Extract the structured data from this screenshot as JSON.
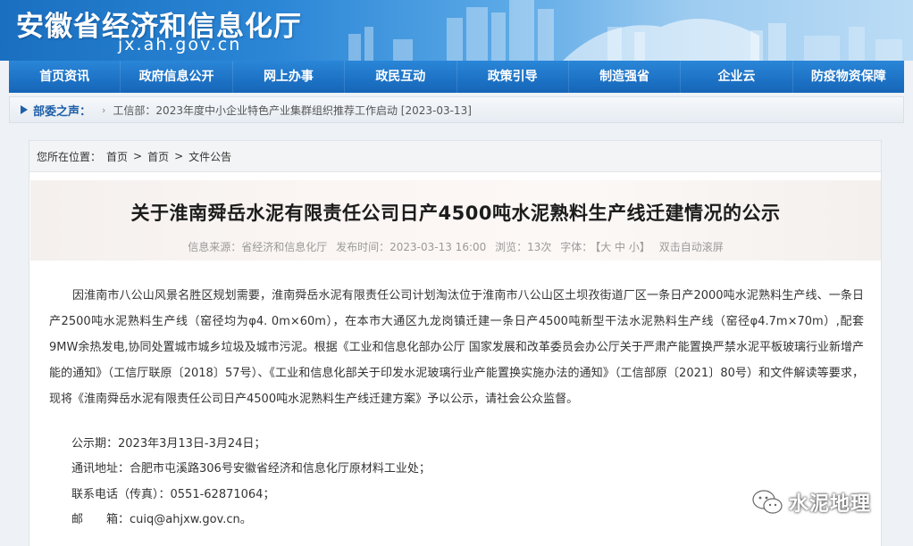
{
  "banner": {
    "title": "安徽省经济和信息化厅",
    "domain": "jx.ah.gov.cn"
  },
  "nav": {
    "items": [
      "首页资讯",
      "政府信息公开",
      "网上办事",
      "政民互动",
      "政策引导",
      "制造强省",
      "企业云",
      "防疫物资保障"
    ]
  },
  "ticker": {
    "label": "部委之声：",
    "bullet": "›",
    "text": "工信部：2023年度中小企业特色产业集群组织推荐工作启动 [2023-03-13]"
  },
  "breadcrumb": {
    "prefix": "您所在位置：",
    "items": [
      "首页",
      "首页",
      "文件公告"
    ],
    "separator": ">"
  },
  "article": {
    "title": "关于淮南舜岳水泥有限责任公司日产4500吨水泥熟料生产线迁建情况的公示",
    "source": "信息来源：省经济和信息化厅",
    "published": "发布时间：2023-03-13 16:00",
    "views": "浏览：13次",
    "font_label": "字体：",
    "font_size_control": "【大 中 小】",
    "autoscroll": "双击自动滚屏",
    "body": "因淮南市八公山风景名胜区规划需要，淮南舜岳水泥有限责任公司计划淘汰位于淮南市八公山区土坝孜街道厂区一条日产2000吨水泥熟料生产线、一条日产2500吨水泥熟料生产线（窑径均为φ4. 0m×60m），在本市大通区九龙岗镇迁建一条日产4500吨新型干法水泥熟料生产线（窑径φ4.7m×70m）,配套9MW余热发电,协同处置城市城乡垃圾及城市污泥。根据《工业和信息化部办公厅 国家发展和改革委员会办公厅关于严肃产能置换严禁水泥平板玻璃行业新增产能的通知》（工信厅联原〔2018〕57号）、《工业和信息化部关于印发水泥玻璃行业产能置换实施办法的通知》（工信部原〔2021〕80号）和文件解读等要求，现将《淮南舜岳水泥有限责任公司日产4500吨水泥熟料生产线迁建方案》予以公示，请社会公众监督。",
    "notice_period": "公示期：2023年3月13日-3月24日；",
    "address": "通讯地址：合肥市屯溪路306号安徽省经济和信息化厅原材料工业处；",
    "phone": "联系电话（传真）：0551-62871064；",
    "email": "邮　　箱：cuiq@ahjxw.gov.cn。"
  },
  "watermark": {
    "text": "水泥地理",
    "icon": "wechat-icon"
  },
  "colors": {
    "nav_blue": "#1a6fc0",
    "ticker_label": "#1e5fa8"
  }
}
